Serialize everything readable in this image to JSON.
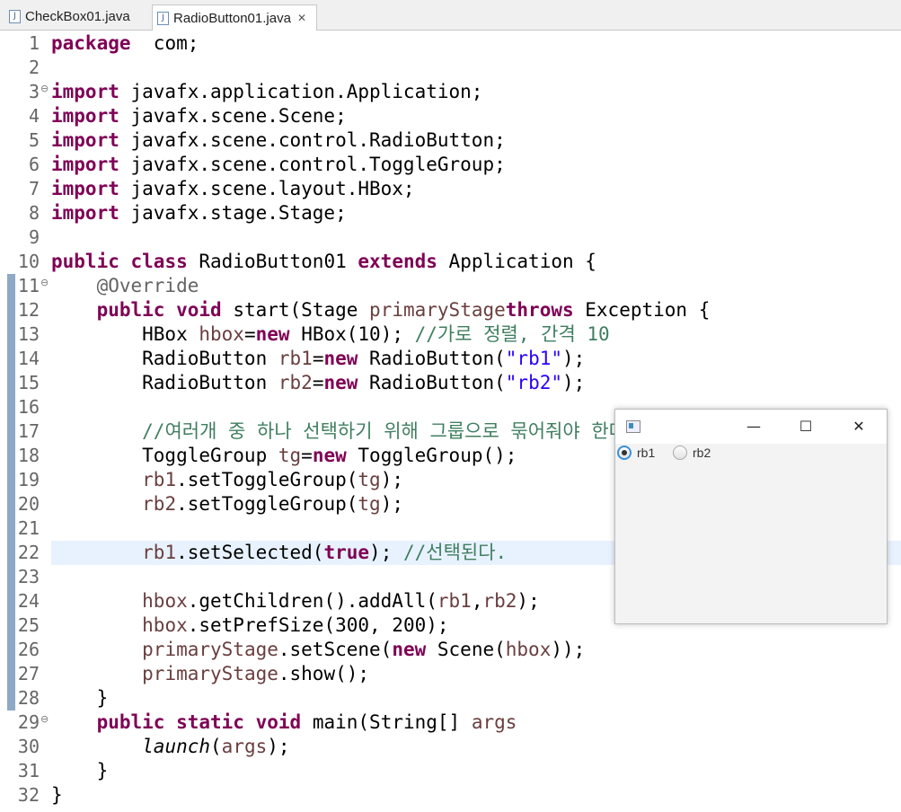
{
  "tabs": [
    {
      "label": "CheckBox01.java",
      "active": false
    },
    {
      "label": "RadioButton01.java",
      "active": true
    }
  ],
  "editor": {
    "current_line": 22,
    "lines": [
      {
        "n": "1",
        "code": [
          [
            "kw",
            "package"
          ],
          [
            "",
            "  com;"
          ]
        ]
      },
      {
        "n": "2",
        "code": []
      },
      {
        "n": "3",
        "fold": true,
        "code": [
          [
            "kw",
            "import"
          ],
          [
            "",
            " javafx.application.Application;"
          ]
        ]
      },
      {
        "n": "4",
        "code": [
          [
            "kw",
            "import"
          ],
          [
            "",
            " javafx.scene.Scene;"
          ]
        ]
      },
      {
        "n": "5",
        "code": [
          [
            "kw",
            "import"
          ],
          [
            "",
            " javafx.scene.control.RadioButton;"
          ]
        ]
      },
      {
        "n": "6",
        "code": [
          [
            "kw",
            "import"
          ],
          [
            "",
            " javafx.scene.control.ToggleGroup;"
          ]
        ]
      },
      {
        "n": "7",
        "code": [
          [
            "kw",
            "import"
          ],
          [
            "",
            " javafx.scene.layout.HBox;"
          ]
        ]
      },
      {
        "n": "8",
        "code": [
          [
            "kw",
            "import"
          ],
          [
            "",
            " javafx.stage.Stage;"
          ]
        ]
      },
      {
        "n": "9",
        "code": []
      },
      {
        "n": "10",
        "code": [
          [
            "kw",
            "public"
          ],
          [
            "",
            " "
          ],
          [
            "kw",
            "class"
          ],
          [
            "",
            " RadioButton01 "
          ],
          [
            "kw",
            "extends"
          ],
          [
            "",
            " Application {"
          ]
        ]
      },
      {
        "n": "11",
        "fold": true,
        "code": [
          [
            "",
            "    "
          ],
          [
            "an",
            "@Override"
          ]
        ]
      },
      {
        "n": "12",
        "code": [
          [
            "",
            "    "
          ],
          [
            "kw",
            "public"
          ],
          [
            "",
            " "
          ],
          [
            "kw",
            "void"
          ],
          [
            "",
            " start(Stage "
          ],
          [
            "var",
            "primaryStage"
          ],
          [
            ") "
          ],
          [
            "kw",
            "throws"
          ],
          [
            "",
            " Exception {"
          ]
        ]
      },
      {
        "n": "13",
        "code": [
          [
            "",
            "        HBox "
          ],
          [
            "var",
            "hbox"
          ],
          [
            "",
            "="
          ],
          [
            "kw",
            "new"
          ],
          [
            "",
            " HBox(10); "
          ],
          [
            "cm",
            "//가로 정렬, 간격 10"
          ]
        ]
      },
      {
        "n": "14",
        "code": [
          [
            "",
            "        RadioButton "
          ],
          [
            "var",
            "rb1"
          ],
          [
            "",
            "="
          ],
          [
            "kw",
            "new"
          ],
          [
            "",
            " RadioButton("
          ],
          [
            "str",
            "\"rb1\""
          ],
          [
            "",
            ");"
          ]
        ]
      },
      {
        "n": "15",
        "code": [
          [
            "",
            "        RadioButton "
          ],
          [
            "var",
            "rb2"
          ],
          [
            "",
            "="
          ],
          [
            "kw",
            "new"
          ],
          [
            "",
            " RadioButton("
          ],
          [
            "str",
            "\"rb2\""
          ],
          [
            "",
            ");"
          ]
        ]
      },
      {
        "n": "16",
        "code": []
      },
      {
        "n": "17",
        "code": [
          [
            "",
            "        "
          ],
          [
            "cm",
            "//여러개 중 하나 선택하기 위해 그룹으로 묶어줘야 한다."
          ]
        ]
      },
      {
        "n": "18",
        "code": [
          [
            "",
            "        ToggleGroup "
          ],
          [
            "var",
            "tg"
          ],
          [
            "",
            "="
          ],
          [
            "kw",
            "new"
          ],
          [
            "",
            " ToggleGroup();"
          ]
        ]
      },
      {
        "n": "19",
        "code": [
          [
            "",
            "        "
          ],
          [
            "var",
            "rb1"
          ],
          [
            "",
            ".setToggleGroup("
          ],
          [
            "var",
            "tg"
          ],
          [
            "",
            ");"
          ]
        ]
      },
      {
        "n": "20",
        "code": [
          [
            "",
            "        "
          ],
          [
            "var",
            "rb2"
          ],
          [
            "",
            ".setToggleGroup("
          ],
          [
            "var",
            "tg"
          ],
          [
            "",
            ");"
          ]
        ]
      },
      {
        "n": "21",
        "code": []
      },
      {
        "n": "22",
        "code": [
          [
            "",
            "        "
          ],
          [
            "var",
            "rb1"
          ],
          [
            "",
            ".setSelected("
          ],
          [
            "kw",
            "true"
          ],
          [
            "",
            "); "
          ],
          [
            "cm",
            "//선택된다."
          ]
        ]
      },
      {
        "n": "23",
        "code": []
      },
      {
        "n": "24",
        "code": [
          [
            "",
            "        "
          ],
          [
            "var",
            "hbox"
          ],
          [
            "",
            ".getChildren().addAll("
          ],
          [
            "var",
            "rb1"
          ],
          [
            "",
            ","
          ],
          [
            "var",
            "rb2"
          ],
          [
            "",
            ");"
          ]
        ]
      },
      {
        "n": "25",
        "code": [
          [
            "",
            "        "
          ],
          [
            "var",
            "hbox"
          ],
          [
            "",
            ".setPrefSize(300, 200);"
          ]
        ]
      },
      {
        "n": "26",
        "code": [
          [
            "",
            "        "
          ],
          [
            "var",
            "primaryStage"
          ],
          [
            "",
            ".setScene("
          ],
          [
            "kw",
            "new"
          ],
          [
            "",
            " Scene("
          ],
          [
            "var",
            "hbox"
          ],
          [
            "",
            "));"
          ]
        ]
      },
      {
        "n": "27",
        "code": [
          [
            "",
            "        "
          ],
          [
            "var",
            "primaryStage"
          ],
          [
            "",
            ".show();"
          ]
        ]
      },
      {
        "n": "28",
        "code": [
          [
            "",
            "    }"
          ]
        ]
      },
      {
        "n": "29",
        "fold": true,
        "code": [
          [
            "",
            "    "
          ],
          [
            "kw",
            "public"
          ],
          [
            "",
            " "
          ],
          [
            "kw",
            "static"
          ],
          [
            "",
            " "
          ],
          [
            "kw",
            "void"
          ],
          [
            "",
            " main(String[] "
          ],
          [
            "var",
            "args"
          ],
          [
            ") {"
          ]
        ]
      },
      {
        "n": "30",
        "code": [
          [
            "",
            "        "
          ],
          [
            "sm",
            "launch"
          ],
          [
            "",
            "("
          ],
          [
            "var",
            "args"
          ],
          [
            "",
            ");"
          ]
        ]
      },
      {
        "n": "31",
        "code": [
          [
            "",
            "    }"
          ]
        ]
      },
      {
        "n": "32",
        "code": [
          [
            "",
            "}"
          ]
        ]
      }
    ]
  },
  "fx_window": {
    "controls": {
      "minimize": "—",
      "maximize": "☐",
      "close": "✕"
    },
    "radio_buttons": [
      {
        "label": "rb1",
        "selected": true
      },
      {
        "label": "rb2",
        "selected": false
      }
    ]
  },
  "colors": {
    "keyword": "#7f0055",
    "string": "#2a00ff",
    "comment": "#3f7f5f",
    "variable": "#6a3e3e",
    "current_line": "#e8f2fe"
  }
}
